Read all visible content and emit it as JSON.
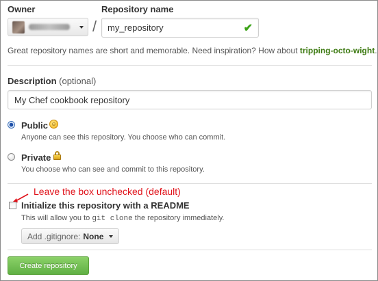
{
  "owner": {
    "label": "Owner"
  },
  "repository": {
    "label": "Repository name",
    "separator": "/",
    "value": "my_repository",
    "valid_icon": "checkmark-icon",
    "hint_prefix": "Great repository names are short and memorable. Need inspiration? How about ",
    "suggestion": "tripping-octo-wight",
    "hint_suffix": "."
  },
  "description": {
    "label": "Description",
    "optional": "(optional)",
    "value": "My Chef cookbook repository"
  },
  "visibility": {
    "selected": "public",
    "public": {
      "label": "Public",
      "desc": "Anyone can see this repository. You choose who can commit."
    },
    "private": {
      "label": "Private",
      "desc": "You choose who can see and commit to this repository."
    }
  },
  "annotation": {
    "text": "Leave the box unchecked (default)",
    "color": "#e0121a"
  },
  "init": {
    "label": "Initialize this repository with a README",
    "checked": false,
    "desc_before": "This will allow you to ",
    "desc_code": "git clone",
    "desc_after": " the repository immediately."
  },
  "gitignore": {
    "prefix": "Add .gitignore:",
    "value": "None"
  },
  "create_button": {
    "label": "Create repository",
    "color": "#60b044"
  }
}
